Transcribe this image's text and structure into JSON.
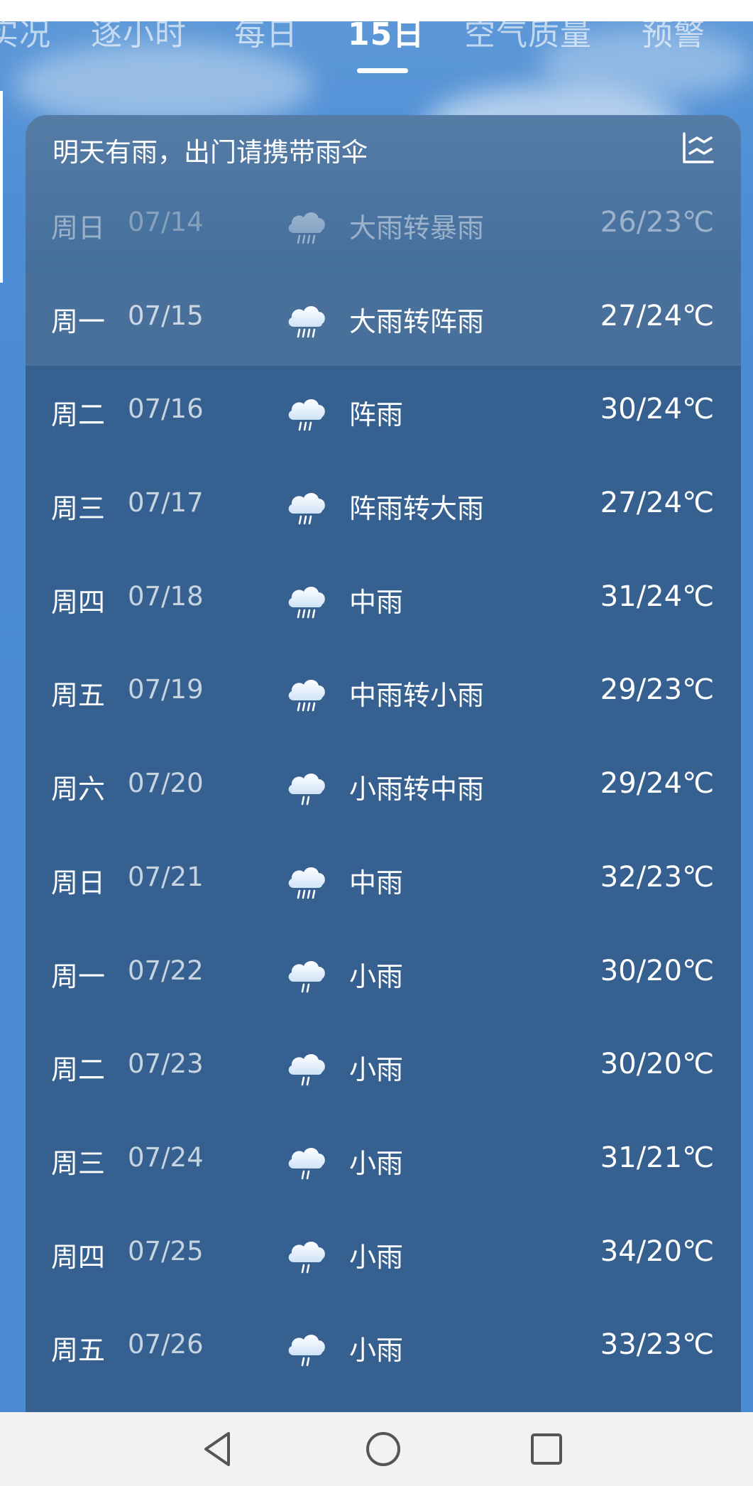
{
  "tabs": [
    {
      "label": "实况",
      "active": false
    },
    {
      "label": "逐小时",
      "active": false
    },
    {
      "label": "每日",
      "active": false
    },
    {
      "label": "15日",
      "active": true
    },
    {
      "label": "空气质量",
      "active": false
    },
    {
      "label": "预警",
      "active": false
    }
  ],
  "card": {
    "hint": "明天有雨，出门请携带雨伞",
    "chart_toggle_icon": "chart-lines-icon"
  },
  "forecast": [
    {
      "weekday": "周日",
      "date": "07/14",
      "icon": "heavy-rain-icon",
      "condition": "大雨转暴雨",
      "temp": "26/23℃",
      "state": "past"
    },
    {
      "weekday": "周一",
      "date": "07/15",
      "icon": "heavy-rain-icon",
      "condition": "大雨转阵雨",
      "temp": "27/24℃",
      "state": "today"
    },
    {
      "weekday": "周二",
      "date": "07/16",
      "icon": "shower-icon",
      "condition": "阵雨",
      "temp": "30/24℃",
      "state": "future"
    },
    {
      "weekday": "周三",
      "date": "07/17",
      "icon": "shower-icon",
      "condition": "阵雨转大雨",
      "temp": "27/24℃",
      "state": "future"
    },
    {
      "weekday": "周四",
      "date": "07/18",
      "icon": "moderate-rain-icon",
      "condition": "中雨",
      "temp": "31/24℃",
      "state": "future"
    },
    {
      "weekday": "周五",
      "date": "07/19",
      "icon": "moderate-rain-icon",
      "condition": "中雨转小雨",
      "temp": "29/23℃",
      "state": "future"
    },
    {
      "weekday": "周六",
      "date": "07/20",
      "icon": "light-rain-icon",
      "condition": "小雨转中雨",
      "temp": "29/24℃",
      "state": "future"
    },
    {
      "weekday": "周日",
      "date": "07/21",
      "icon": "moderate-rain-icon",
      "condition": "中雨",
      "temp": "32/23℃",
      "state": "future"
    },
    {
      "weekday": "周一",
      "date": "07/22",
      "icon": "light-rain-icon",
      "condition": "小雨",
      "temp": "30/20℃",
      "state": "future"
    },
    {
      "weekday": "周二",
      "date": "07/23",
      "icon": "light-rain-icon",
      "condition": "小雨",
      "temp": "30/20℃",
      "state": "future"
    },
    {
      "weekday": "周三",
      "date": "07/24",
      "icon": "light-rain-icon",
      "condition": "小雨",
      "temp": "31/21℃",
      "state": "future"
    },
    {
      "weekday": "周四",
      "date": "07/25",
      "icon": "light-rain-icon",
      "condition": "小雨",
      "temp": "34/20℃",
      "state": "future"
    },
    {
      "weekday": "周五",
      "date": "07/26",
      "icon": "light-rain-icon",
      "condition": "小雨",
      "temp": "33/23℃",
      "state": "future"
    }
  ],
  "navbar": {
    "back_icon": "back-triangle-icon",
    "home_icon": "home-circle-icon",
    "recents_icon": "recents-square-icon"
  },
  "colors": {
    "sky": "#4a8bd4",
    "card": "#35608f",
    "text": "#ffffff"
  }
}
